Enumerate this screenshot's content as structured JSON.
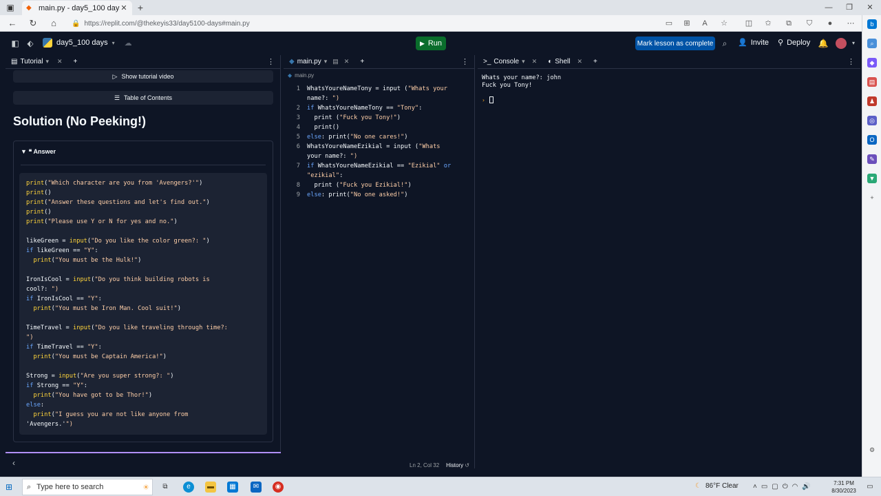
{
  "browser": {
    "tab_title": "main.py - day5_100 days - Replit",
    "url": "https://replit.com/@thekeyis33/day5100-days#main.py"
  },
  "topbar": {
    "project_name": "day5_100 days",
    "run_label": "Run",
    "mark_complete_label": "Mark lesson as complete",
    "invite_label": "Invite",
    "deploy_label": "Deploy"
  },
  "tutorial": {
    "tab_label": "Tutorial",
    "show_video_label": "Show tutorial video",
    "toc_label": "Table of Contents",
    "solution_title": "Solution (No Peeking!)",
    "answer_label": "Answer",
    "code_lines": [
      "print(\"Which character are you from 'Avengers?'\")",
      "print()",
      "print(\"Answer these questions and let's find out.\")",
      "print()",
      "print(\"Please use Y or N for yes and no.\")",
      "",
      "likeGreen = input(\"Do you like the color green?: \")",
      "if likeGreen == \"Y\":",
      "  print(\"You must be the Hulk!\")",
      "",
      "IronIsCool = input(\"Do you think building robots is",
      "cool?: \")",
      "if IronIsCool == \"Y\":",
      "  print(\"You must be Iron Man. Cool suit!\")",
      "",
      "TimeTravel = input(\"Do you like traveling through time?:",
      "\")",
      "if TimeTravel == \"Y\":",
      "  print(\"You must be Captain America!\")",
      "",
      "Strong = input(\"Are you super strong?: \")",
      "if Strong == \"Y\":",
      "  print(\"You have got to be Thor!\")",
      "else:",
      "  print(\"I guess you are not like anyone from",
      "'Avengers.'\")"
    ]
  },
  "editor": {
    "tab_label": "main.py",
    "breadcrumb": "main.py",
    "lines": [
      {
        "n": "1",
        "text": "WhatsYoureNameTony = input (\"Whats your"
      },
      {
        "n": "",
        "text": "name?: \")"
      },
      {
        "n": "2",
        "text": "if WhatsYoureNameTony == \"Tony\":"
      },
      {
        "n": "3",
        "text": "  print (\"Fuck you Tony!\")"
      },
      {
        "n": "4",
        "text": "  print()"
      },
      {
        "n": "5",
        "text": "else: print(\"No one cares!\")"
      },
      {
        "n": "6",
        "text": "WhatsYoureNameEzikial = input (\"Whats"
      },
      {
        "n": "",
        "text": "your name?: \")"
      },
      {
        "n": "7",
        "text": "if WhatsYoureNameEzikial == \"Ezikial\" or"
      },
      {
        "n": "",
        "text": "\"ezikial\":"
      },
      {
        "n": "8",
        "text": "  print (\"Fuck you Ezikial!\")"
      },
      {
        "n": "9",
        "text": "else: print(\"No one asked!\")"
      }
    ],
    "status_position": "Ln 2, Col 32",
    "history_label": "History"
  },
  "console": {
    "tab_label": "Console",
    "shell_label": "Shell",
    "output": "Whats your name?: john\nFuck you Tony!"
  },
  "taskbar": {
    "search_placeholder": "Type here to search",
    "weather": "86°F  Clear",
    "time": "7:31 PM",
    "date": "8/30/2023"
  }
}
